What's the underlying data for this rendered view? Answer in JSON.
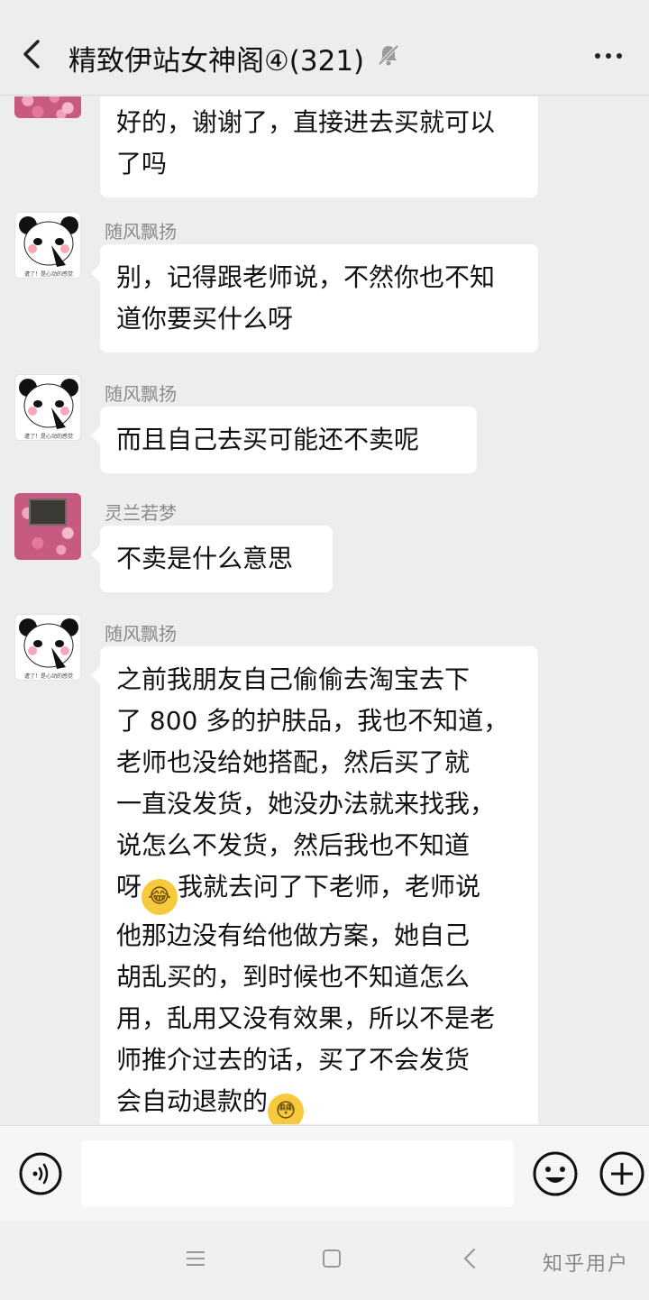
{
  "header": {
    "title": "精致伊站女神阁④(321)"
  },
  "messages": [
    {
      "avatar": "flower",
      "sender": "",
      "text": "好的，谢谢了，直接进去买就可以\n了吗"
    },
    {
      "avatar": "panda",
      "avatar_caption": "遭了！是心动的感觉",
      "sender": "随风飘扬",
      "text": "别，记得跟老师说，不然你也不知\n道你要买什么呀"
    },
    {
      "avatar": "panda",
      "avatar_caption": "遭了！是心动的感觉",
      "sender": "随风飘扬",
      "text": "而且自己去买可能还不卖呢"
    },
    {
      "avatar": "flower",
      "sender": "灵兰若梦",
      "text": "不卖是什么意思"
    },
    {
      "avatar": "panda",
      "avatar_caption": "遭了！是心动的感觉",
      "sender": "随风飘扬",
      "lines": [
        "之前我朋友自己偷偷去淘宝去下",
        "了 800 多的护肤品，我也不知道，",
        "老师也没给她搭配，然后买了就",
        "一直没发货，她没办法就来找我，",
        "说怎么不发货，然后我也不知道",
        "呀",
        "我就去问了下老师，老师说",
        "他那边没有给他做方案，她自己",
        "胡乱买的，到时候也不知道怎么",
        "用，乱用又没有效果，所以不是老",
        "师推介过去的话，买了不会发货",
        "会自动退款的"
      ],
      "emojis": [
        "laughing-tears",
        "flushed"
      ]
    }
  ],
  "input": {
    "value": "",
    "placeholder": ""
  },
  "watermark": "知乎用户",
  "colors": {
    "background": "#ededed",
    "bubble": "#ffffff",
    "sender": "#8a8a8a"
  }
}
